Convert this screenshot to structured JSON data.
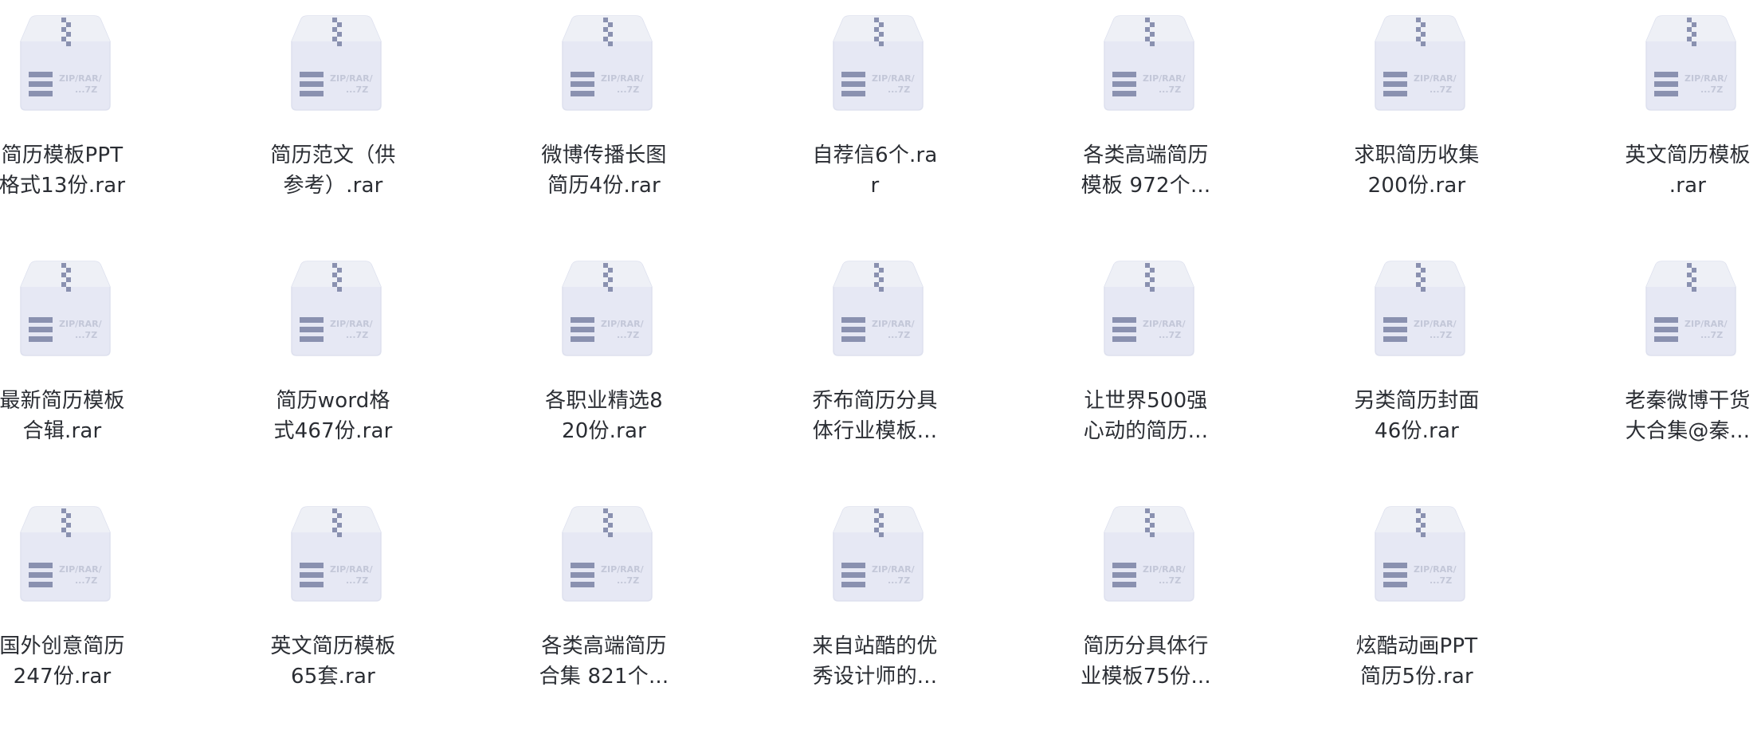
{
  "icon": {
    "name": "archive-file-icon",
    "badge_text_1": "ZIP/RAR/",
    "badge_text_2": "...7Z"
  },
  "colors": {
    "text": "#2a2d33",
    "icon_top": "#eef0f6",
    "icon_body": "#e6e8f4",
    "icon_zip": "#8a91b0",
    "icon_lines": "#8a91b0",
    "badge_text": "#c3c7d8"
  },
  "files": [
    {
      "line1": "简历模板PPT",
      "line2": "格式13份.rar"
    },
    {
      "line1": "简历范文（供",
      "line2": "参考）.rar"
    },
    {
      "line1": "微博传播长图",
      "line2": "简历4份.rar"
    },
    {
      "line1": "自荐信6个.ra",
      "line2": "r"
    },
    {
      "line1": "各类高端简历",
      "line2": "模板 972个..."
    },
    {
      "line1": "求职简历收集",
      "line2": "200份.rar"
    },
    {
      "line1": "英文简历模板",
      "line2": ".rar"
    },
    {
      "line1": "最新简历模板",
      "line2": "合辑.rar"
    },
    {
      "line1": "简历word格",
      "line2": "式467份.rar"
    },
    {
      "line1": "各职业精选8",
      "line2": "20份.rar"
    },
    {
      "line1": "乔布简历分具",
      "line2": "体行业模板..."
    },
    {
      "line1": "让世界500强",
      "line2": "心动的简历..."
    },
    {
      "line1": "另类简历封面",
      "line2": "46份.rar"
    },
    {
      "line1": "老秦微博干货",
      "line2": "大合集@秦..."
    },
    {
      "line1": "国外创意简历",
      "line2": "247份.rar"
    },
    {
      "line1": "英文简历模板",
      "line2": "65套.rar"
    },
    {
      "line1": "各类高端简历",
      "line2": "合集 821个..."
    },
    {
      "line1": "来自站酷的优",
      "line2": "秀设计师的..."
    },
    {
      "line1": "简历分具体行",
      "line2": "业模板75份..."
    },
    {
      "line1": "炫酷动画PPT",
      "line2": "简历5份.rar"
    }
  ]
}
